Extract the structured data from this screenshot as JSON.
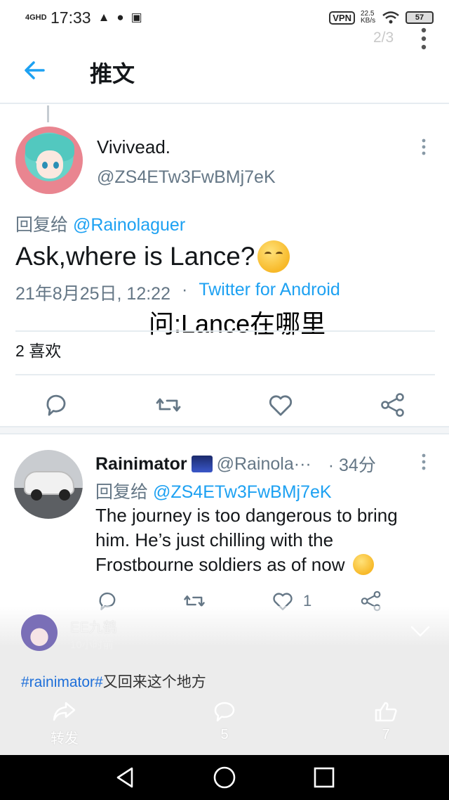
{
  "status_bar": {
    "network": "4GHD",
    "time": "17:33",
    "vpn": "VPN",
    "speed": "22.5 KB/s",
    "battery": "57"
  },
  "viewer": {
    "counter": "2/3",
    "poster_name": "EE九鹤",
    "poster_sub": "10小时前",
    "caption_tag": "#rainimator#",
    "caption_text": "又回来这个地方",
    "share_label": "转发",
    "comment_count": "5",
    "like_count": "7"
  },
  "header": {
    "title": "推文"
  },
  "tweet": {
    "name": "Vivivead.",
    "handle": "@ZS4ETw3FwBMj7eK",
    "reply_prefix": "回复给",
    "reply_to": "@Rainolaguer",
    "text": "Ask,where is Lance?",
    "date": "21年8月25日, 12:22",
    "dot": "·",
    "source": "Twitter for Android",
    "overlay_caption": "问:Lance在哪里",
    "likes_count": "2",
    "likes_label": "喜欢"
  },
  "reply": {
    "name": "Rainimator",
    "handle": "@Rainola···",
    "time": "· 34分",
    "reply_prefix": "回复给",
    "reply_to": "@ZS4ETw3FwBMj7eK",
    "text": "The journey is too dangerous to bring him. He’s just chilling with the Frostbourne soldiers as of now",
    "like_count": "1"
  }
}
